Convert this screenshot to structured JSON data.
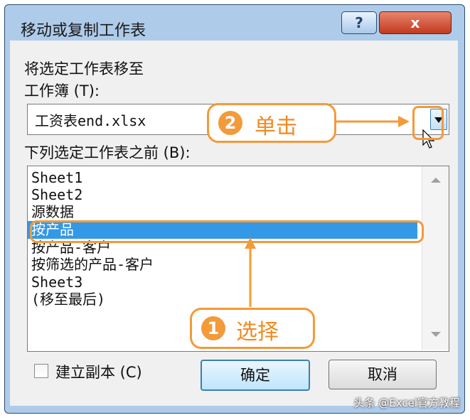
{
  "window": {
    "title": "移动或复制工作表",
    "help_label": "?",
    "close_label": "x"
  },
  "dialog": {
    "instruction": "将选定工作表移至",
    "workbook_label": "工作簿 (T):",
    "workbook_value": "工资表end.xlsx",
    "before_label": "下列选定工作表之前 (B):",
    "sheets": [
      "Sheet1",
      "Sheet2",
      "源数据",
      "按产品",
      "按产品-客户",
      "按筛选的产品-客户",
      "Sheet3",
      "(移至最后)"
    ],
    "selected_sheet": "按产品",
    "copy_checkbox": {
      "label": "建立副本 (C)",
      "checked": false
    },
    "ok_label": "确定",
    "cancel_label": "取消"
  },
  "annotations": {
    "step1": {
      "number": "1",
      "text": "选择"
    },
    "step2": {
      "number": "2",
      "text": "单击"
    },
    "color": "#f39a3a"
  },
  "watermark": "头条 @Excel官方教程",
  "colors": {
    "title_bg": "#aecbea",
    "selection": "#3399e6",
    "close_button": "#c23a1f"
  }
}
